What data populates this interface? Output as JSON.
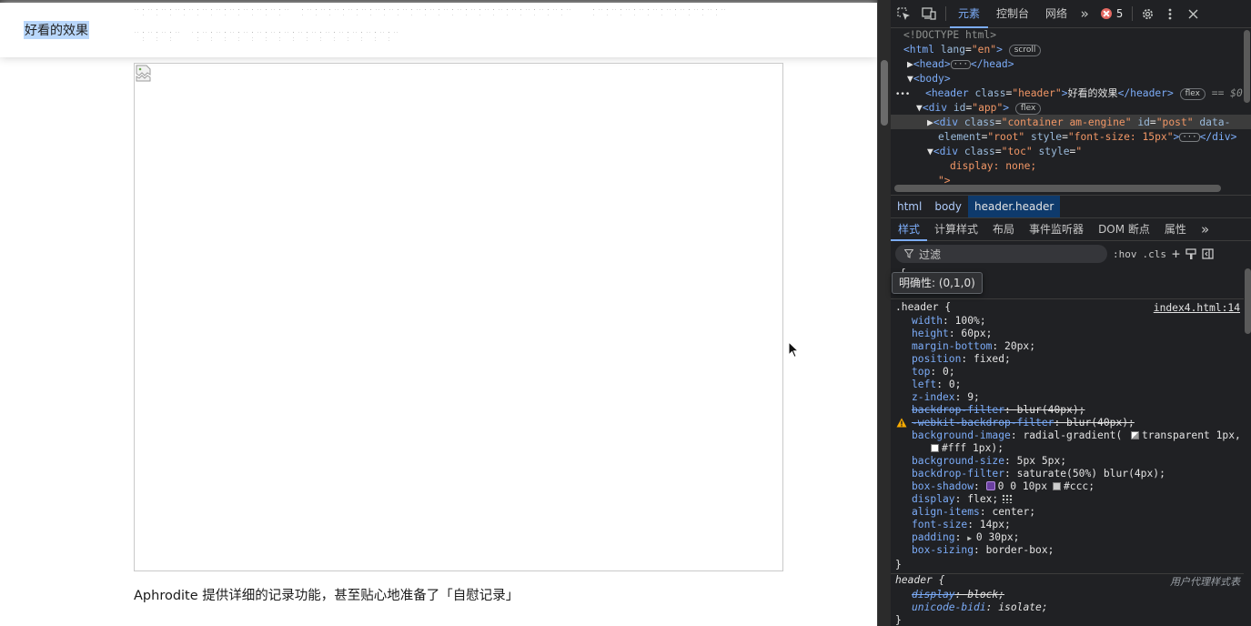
{
  "page": {
    "header_title": "好看的效果",
    "caption": "Aphrodite 提供详细的记录功能，甚至贴心地准备了「自慰记录」"
  },
  "devtools": {
    "tabs": [
      "元素",
      "控制台",
      "网络"
    ],
    "error_count": "5",
    "dom": {
      "doctype": "<!DOCTYPE html>",
      "html_open_tag": "<html",
      "html_lang_attr": "lang",
      "html_lang_value": "\"en\"",
      "html_close": ">",
      "scroll_pill": "scroll",
      "head_open": "<head>",
      "head_close": "</head>",
      "body_open": "<body>",
      "header_open": "<header",
      "header_class_attr": "class",
      "header_class_value": "\"header\"",
      "header_text": "好看的效果",
      "header_close": "</header>",
      "flex_pill": "flex",
      "eq_dollar": "== $0",
      "app_open": "<div",
      "app_id_attr": "id",
      "app_id_value": "\"app\"",
      "container_open": "<div",
      "container_class_attr": "class",
      "container_class_value": "\"container am-engine\"",
      "container_id_attr": "id",
      "container_id_value": "\"post\"",
      "container_data_attr": "data-",
      "container_line2_attr": "element",
      "container_line2_value": "\"root\"",
      "container_style_attr": "style",
      "container_style_value": "\"font-size: 15px\"",
      "div_close": "</div>",
      "toc_open": "<div",
      "toc_class_attr": "class",
      "toc_class_value": "\"toc\"",
      "toc_style_attr": "style",
      "toc_style_value": "\"",
      "toc_css": "display: none;",
      "toc_end": "\">"
    },
    "breadcrumbs": [
      "html",
      "body",
      "header.header"
    ],
    "subtabs": [
      "样式",
      "计算样式",
      "布局",
      "事件监听器",
      "DOM 断点",
      "属性"
    ],
    "filter_placeholder": "过滤",
    "filter_hov": ":hov",
    "filter_cls": ".cls",
    "specificity_tooltip": "明确性: (0,1,0)",
    "rule_selector": ".header {",
    "rule_source": "index4.html:14",
    "declarations": [
      {
        "prop": "width",
        "value": "100%;"
      },
      {
        "prop": "height",
        "value": "60px;"
      },
      {
        "prop": "margin-bottom",
        "value": "20px;"
      },
      {
        "prop": "position",
        "value": "fixed;"
      },
      {
        "prop": "top",
        "value": "0;"
      },
      {
        "prop": "left",
        "value": "0;"
      },
      {
        "prop": "z-index",
        "value": "9;"
      },
      {
        "prop": "backdrop-filter",
        "value": "blur(40px);"
      },
      {
        "prop": "-webkit-backdrop-filter",
        "value": "blur(40px);"
      },
      {
        "prop": "background-image",
        "value": "radial-gradient("
      },
      {
        "prop": "",
        "value": "transparent 1px,"
      },
      {
        "prop": "",
        "value": "#fff 1px);"
      },
      {
        "prop": "background-size",
        "value": "5px 5px;"
      },
      {
        "prop": "backdrop-filter",
        "value": "saturate(50%) blur(4px);"
      },
      {
        "prop": "box-shadow",
        "value": "0 0 10px"
      },
      {
        "prop": "",
        "value": "#ccc;"
      },
      {
        "prop": "display",
        "value": "flex;"
      },
      {
        "prop": "align-items",
        "value": "center;"
      },
      {
        "prop": "font-size",
        "value": "14px;"
      },
      {
        "prop": "padding",
        "value": "0 30px;"
      },
      {
        "prop": "box-sizing",
        "value": "border-box;"
      }
    ],
    "rule_close": "}",
    "ua_selector": "header {",
    "ua_source": "用户代理样式表",
    "ua_declarations": [
      {
        "prop": "display",
        "value": "block;"
      },
      {
        "prop": "unicode-bidi",
        "value": "isolate;"
      }
    ],
    "colors": {
      "accent": "#7cacf8",
      "error": "#e46962",
      "panel_bg": "#202124"
    }
  }
}
